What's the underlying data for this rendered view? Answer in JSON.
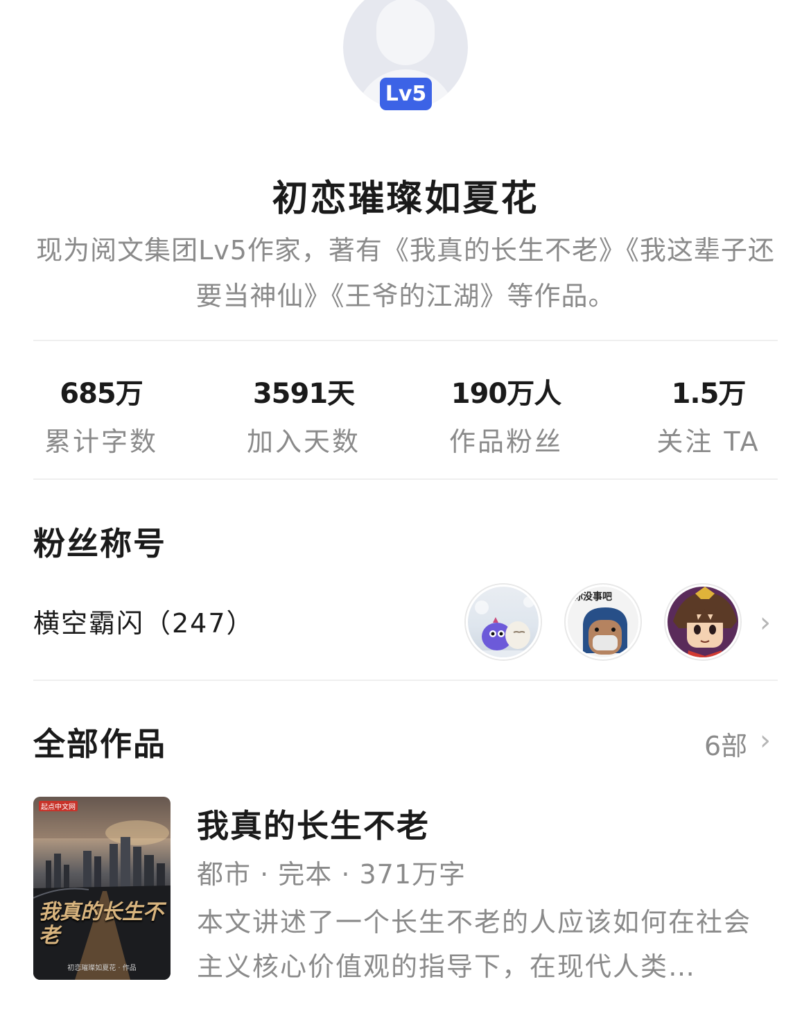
{
  "profile": {
    "level_badge": "Lv5",
    "name": "初恋璀璨如夏花",
    "bio": "现为阅文集团Lv5作家，著有《我真的长生不老》《我这辈子还要当神仙》《王爷的江湖》等作品。"
  },
  "stats": [
    {
      "value": "685万",
      "label": "累计字数"
    },
    {
      "value": "3591天",
      "label": "加入天数"
    },
    {
      "value": "190万人",
      "label": "作品粉丝"
    },
    {
      "value": "1.5万",
      "label": "关注 TA"
    }
  ],
  "fans_section": {
    "title": "粉丝称号",
    "fan_title": "横空霸闪（247）",
    "avatars": [
      {
        "icon": "fluffy-birds-avatar"
      },
      {
        "icon": "masked-face-avatar",
        "caption": "你没事吧"
      },
      {
        "icon": "anime-character-avatar"
      }
    ]
  },
  "works_section": {
    "title": "全部作品",
    "count": "6部"
  },
  "book": {
    "cover_publisher": "起点中文网",
    "cover_title": "我真的长生不老",
    "cover_author": "初恋璀璨如夏花 · 作品",
    "title": "我真的长生不老",
    "meta": "都市 · 完本 · 371万字",
    "description": "本文讲述了一个长生不老的人应该如何在社会主义核心价值观的指导下，在现代人类…"
  },
  "colors": {
    "accent": "#3c63e6",
    "secondary_text": "#8a8a8a",
    "primary_text": "#1a1a1a",
    "divider": "#efefef"
  }
}
